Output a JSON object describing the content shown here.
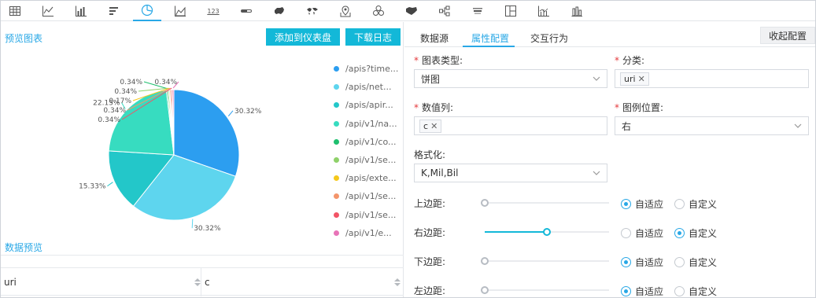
{
  "toolbar": {
    "icons": [
      "table-icon",
      "line-chart-icon",
      "bar-chart-icon",
      "horizontal-bar-icon",
      "pie-chart-icon",
      "area-chart-icon",
      "kpi-number-icon",
      "progress-bar-icon",
      "china-map-icon",
      "world-map-icon",
      "location-map-icon",
      "bubble-icon",
      "heat-map-icon",
      "tree-icon",
      "word-cloud-icon",
      "layout-icon",
      "column-line-icon",
      "stacked-bar-icon"
    ],
    "kpi_label": "123",
    "active_index": 4
  },
  "preview": {
    "title": "预览图表",
    "add_dashboard_button": "添加到仪表盘",
    "download_log_button": "下载日志"
  },
  "chart_data": {
    "type": "pie",
    "labels": [
      "/apis?time...",
      "/apis/net...",
      "/apis/apir...",
      "/api/v1/na...",
      "/api/v1/co...",
      "/api/v1/se...",
      "/apis/exte...",
      "/api/v1/se...",
      "/api/v1/se...",
      "/api/v1/e..."
    ],
    "values": [
      30.32,
      30.32,
      15.33,
      22.15,
      0.34,
      0.34,
      0.17,
      0.34,
      0.34,
      0.34
    ],
    "label_texts": [
      "30.32%",
      "30.32%",
      "15.33%",
      "22.15%",
      "0.34%",
      "0.34%",
      "0.17%",
      "0.34%",
      "0.34%",
      "0.34%"
    ],
    "colors": [
      "#2c9ef0",
      "#5ed5ee",
      "#23c7c9",
      "#37dcc0",
      "#1ebf6e",
      "#8fd16a",
      "#f5c81b",
      "#f4956b",
      "#f25466",
      "#e874b8"
    ],
    "legend_position": "right"
  },
  "data_preview": {
    "title": "数据预览",
    "columns": [
      "uri",
      "c"
    ]
  },
  "config": {
    "tabs": [
      "数据源",
      "属性配置",
      "交互行为"
    ],
    "active_tab": 1,
    "collapse_button": "收起配置",
    "chart_type_label": "图表类型:",
    "chart_type_value": "饼图",
    "category_label": "分类:",
    "category_tag": "uri",
    "value_col_label": "数值列:",
    "value_col_tag": "c",
    "legend_pos_label": "图例位置:",
    "legend_pos_value": "右",
    "format_label": "格式化:",
    "format_value": "K,Mil,Bil",
    "auto_label": "自适应",
    "custom_label": "自定义",
    "margins": [
      {
        "label": "上边距:",
        "mode": "auto",
        "level": 0
      },
      {
        "label": "右边距:",
        "mode": "custom",
        "level": 0.5
      },
      {
        "label": "下边距:",
        "mode": "auto",
        "level": 0
      },
      {
        "label": "左边距:",
        "mode": "auto",
        "level": 0
      }
    ]
  }
}
